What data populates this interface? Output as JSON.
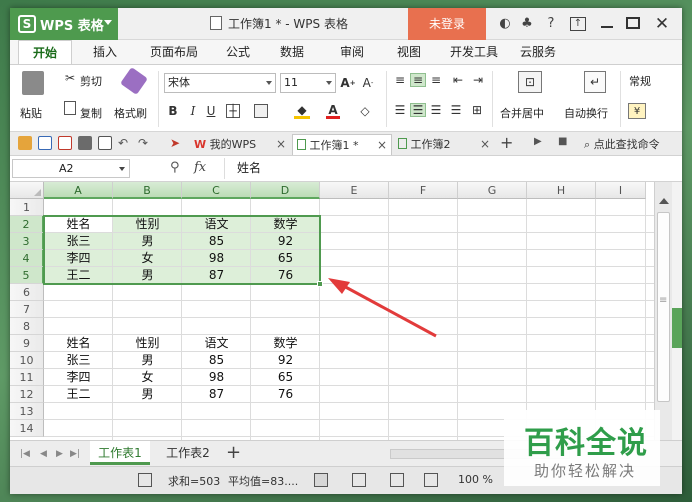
{
  "title_bar": {
    "app_name": "WPS 表格",
    "doc_title": "工作簿1 * - WPS 表格",
    "login_label": "未登录",
    "help_label": "?"
  },
  "menu_tabs": [
    "开始",
    "插入",
    "页面布局",
    "公式",
    "数据",
    "审阅",
    "视图",
    "开发工具",
    "云服务"
  ],
  "ribbon": {
    "paste": "粘贴",
    "cut": "剪切",
    "copy": "复制",
    "format_painter": "格式刷",
    "font_name": "宋体",
    "font_size": "11",
    "merge_center": "合并居中",
    "wrap_text": "自动换行",
    "number_format": "常规",
    "bold": "B",
    "italic": "I",
    "underline": "U"
  },
  "doc_tabs": {
    "my_wps": "我的WPS",
    "book1": "工作簿1 *",
    "book2": "工作簿2",
    "search_hint": "点此查找命令"
  },
  "formula_bar": {
    "cell_ref": "A2",
    "fx": "fx",
    "content": "姓名"
  },
  "grid": {
    "columns": [
      "A",
      "B",
      "C",
      "D",
      "E",
      "F",
      "G",
      "H",
      "I"
    ],
    "rows": [
      "1",
      "2",
      "3",
      "4",
      "5",
      "6",
      "7",
      "8",
      "9",
      "10",
      "11",
      "12",
      "13",
      "14"
    ],
    "cells": {
      "2": [
        "姓名",
        "性别",
        "语文",
        "数学"
      ],
      "3": [
        "张三",
        "男",
        "85",
        "92"
      ],
      "4": [
        "李四",
        "女",
        "98",
        "65"
      ],
      "5": [
        "王二",
        "男",
        "87",
        "76"
      ],
      "9": [
        "姓名",
        "性别",
        "语文",
        "数学"
      ],
      "10": [
        "张三",
        "男",
        "85",
        "92"
      ],
      "11": [
        "李四",
        "女",
        "98",
        "65"
      ],
      "12": [
        "王二",
        "男",
        "87",
        "76"
      ]
    }
  },
  "sheet_tabs": [
    "工作表1",
    "工作表2"
  ],
  "status_bar": {
    "sum": "求和=503",
    "average": "平均值=83....",
    "zoom": "100 %"
  },
  "watermark": {
    "title": "百科全说",
    "subtitle": "助你轻松解决"
  },
  "colors": {
    "accent": "#4f9a4f",
    "selection": "#c1e2ba",
    "login": "#e8704f",
    "arrow": "#e23b3b"
  }
}
